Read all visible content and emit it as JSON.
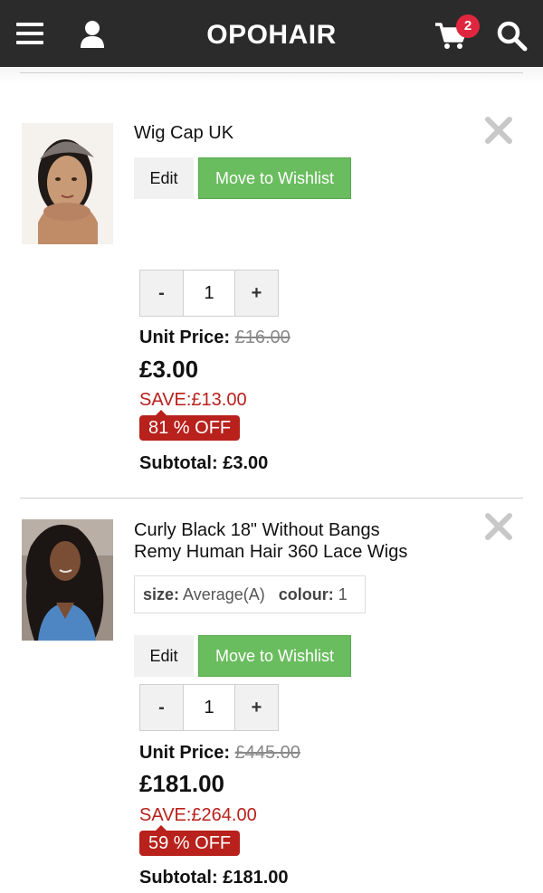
{
  "header": {
    "brand": "OPOHAIR",
    "cart_count": "2"
  },
  "items": [
    {
      "title_line1": "Wig Cap UK",
      "edit_label": "Edit",
      "wishlist_label": "Move to Wishlist",
      "quantity": "1",
      "minus_label": "-",
      "plus_label": "+",
      "unit_price_label": "Unit Price:",
      "original_price": "£16.00",
      "price": "£3.00",
      "save": "SAVE:£13.00",
      "discount": "81 % OFF",
      "subtotal": "Subtotal: £3.00"
    },
    {
      "title_line1": "Curly Black 18\" Without Bangs",
      "title_line2": "Remy Human Hair 360 Lace Wigs",
      "size_label": "size:",
      "size_value": "Average(A)",
      "colour_label": "colour:",
      "colour_value": "1",
      "edit_label": "Edit",
      "wishlist_label": "Move to Wishlist",
      "quantity": "1",
      "minus_label": "-",
      "plus_label": "+",
      "unit_price_label": "Unit Price:",
      "original_price": "£445.00",
      "price": "£181.00",
      "save": "SAVE:£264.00",
      "discount": "59 % OFF",
      "subtotal": "Subtotal: £181.00"
    }
  ],
  "colors": {
    "header_bg": "#2b2b2b",
    "badge": "#e0263e",
    "wishlist_green": "#6abd5f",
    "discount_red": "#b8211c"
  },
  "icons": [
    "menu-icon",
    "user-icon",
    "cart-icon",
    "search-icon",
    "close-icon"
  ]
}
